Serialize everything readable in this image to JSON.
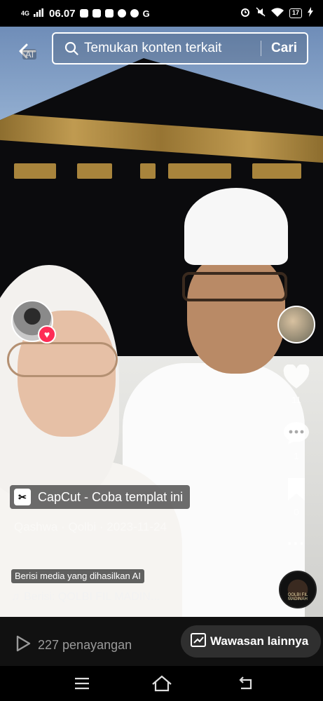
{
  "status_bar": {
    "network": "4G",
    "time": "06.07",
    "battery": "17"
  },
  "search": {
    "ai_chip": "AI",
    "placeholder": "Temukan konten terkait",
    "button": "Cari"
  },
  "actions": {
    "likes": "11",
    "comments": "1",
    "saves": "0",
    "more": "..."
  },
  "capcut": {
    "logo": "✂",
    "label": "CapCut - Coba templat ini"
  },
  "caption_faint": "Qashwa · Qolbi · 2023-11-24",
  "ai_label": "Berisi media yang dihasilkan AI",
  "sound": "Berisi: QOLBI FIL MADIN...",
  "music_disc_text": "QOLBI FIL MADINAH",
  "bottom": {
    "views": "227 penayangan",
    "insight": "Wawasan lainnya"
  },
  "icons": [
    "back-arrow-icon",
    "search-icon",
    "heart-icon",
    "comment-icon",
    "bookmark-icon",
    "more-icon",
    "play-icon",
    "chart-icon",
    "menu-icon",
    "home-icon",
    "back-icon"
  ],
  "colors": {
    "heart_badge": "#fe2c55",
    "bottom_bar": "#111111"
  }
}
